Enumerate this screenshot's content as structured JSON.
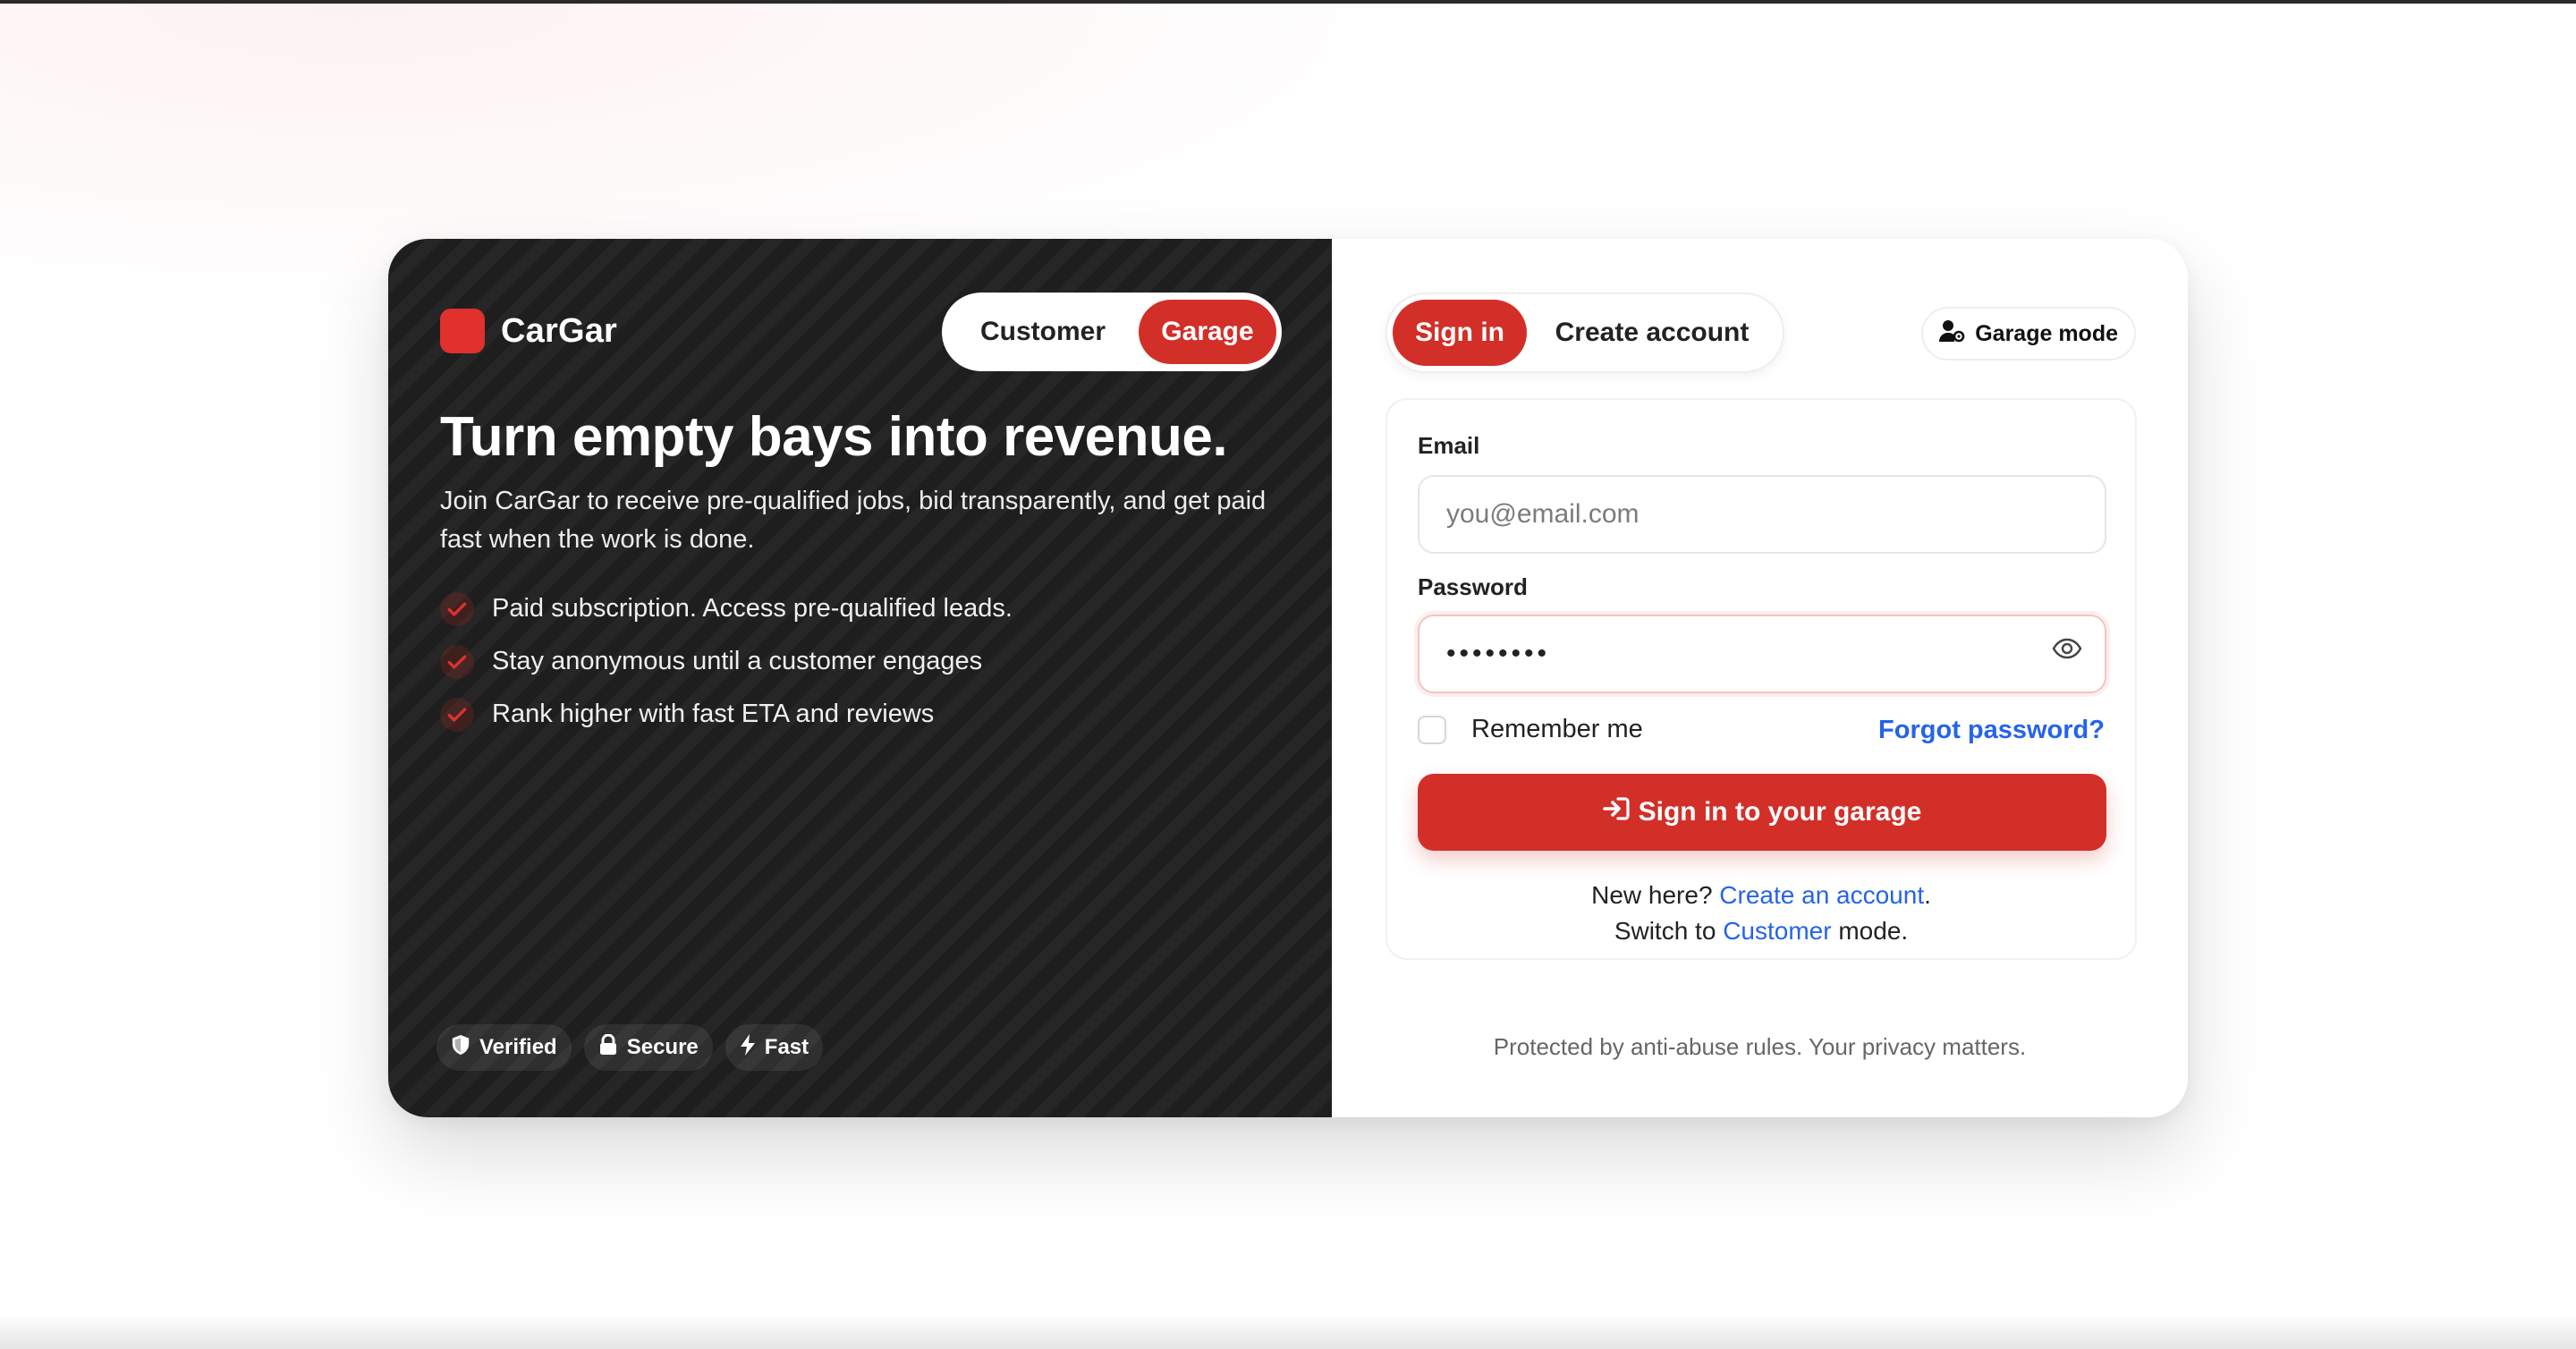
{
  "brand": {
    "name": "CarGar"
  },
  "role_toggle": {
    "customer": "Customer",
    "garage": "Garage"
  },
  "hero": {
    "headline": "Turn empty bays into revenue.",
    "subtext": "Join CarGar to receive pre-qualified jobs, bid transparently, and get paid fast when the work is done.",
    "features": [
      "Paid subscription. Access pre-qualified leads.",
      "Stay anonymous until a customer engages",
      "Rank higher with fast ETA and reviews"
    ],
    "badges": [
      "Verified",
      "Secure",
      "Fast"
    ]
  },
  "auth_tabs": {
    "signin": "Sign in",
    "create": "Create account"
  },
  "mode_button": {
    "label": "Garage mode"
  },
  "form": {
    "email_label": "Email",
    "email_placeholder": "you@email.com",
    "password_label": "Password",
    "password_value": "••••••••",
    "remember_label": "Remember me",
    "remember_checked": false,
    "forgot_link": "Forgot password?",
    "submit_label": "Sign in to your garage",
    "new_here_prefix": "New here?",
    "create_link": "Create an account",
    "switch_prefix": "Switch to",
    "switch_link": "Customer",
    "switch_suffix": "mode."
  },
  "footer_note": "Protected by anti-abuse rules. Your privacy matters.",
  "colors": {
    "accent": "#d22f29",
    "link": "#2563eb",
    "dark_panel": "#1e1e1e"
  },
  "icons": [
    "check-icon",
    "shield-icon",
    "lock-icon",
    "bolt-icon",
    "user-gear-icon",
    "eye-icon",
    "sign-in-arrow-icon"
  ]
}
